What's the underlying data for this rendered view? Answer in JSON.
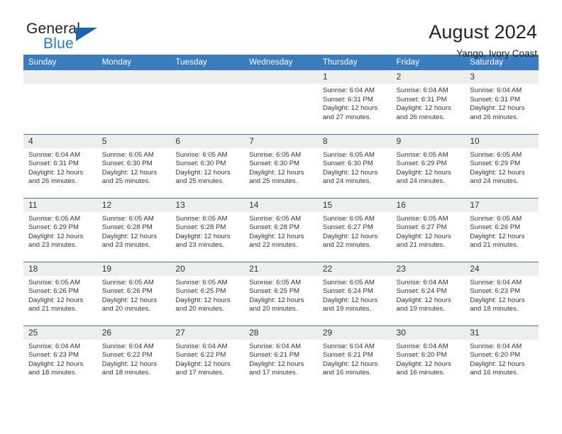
{
  "brand": {
    "name_part1": "General",
    "name_part2": "Blue",
    "triangle_icon": "triangle-icon",
    "accent_color": "#1665ad",
    "blue_text_color": "#1f7fc4"
  },
  "header": {
    "title": "August 2024",
    "location": "Yango, Ivory Coast"
  },
  "theme": {
    "header_row_bg": "#3a7cbe",
    "daynum_bg": "#eeeeee",
    "text_color": "#333333"
  },
  "weekday_headers": [
    "Sunday",
    "Monday",
    "Tuesday",
    "Wednesday",
    "Thursday",
    "Friday",
    "Saturday"
  ],
  "labels": {
    "sunrise": "Sunrise:",
    "sunset": "Sunset:",
    "daylight": "Daylight:"
  },
  "weeks": [
    [
      {
        "day": "",
        "empty": true
      },
      {
        "day": "",
        "empty": true
      },
      {
        "day": "",
        "empty": true
      },
      {
        "day": "",
        "empty": true
      },
      {
        "day": "1",
        "sunrise": "Sunrise: 6:04 AM",
        "sunset": "Sunset: 6:31 PM",
        "daylight_1": "Daylight: 12 hours",
        "daylight_2": "and 27 minutes."
      },
      {
        "day": "2",
        "sunrise": "Sunrise: 6:04 AM",
        "sunset": "Sunset: 6:31 PM",
        "daylight_1": "Daylight: 12 hours",
        "daylight_2": "and 26 minutes."
      },
      {
        "day": "3",
        "sunrise": "Sunrise: 6:04 AM",
        "sunset": "Sunset: 6:31 PM",
        "daylight_1": "Daylight: 12 hours",
        "daylight_2": "and 26 minutes."
      }
    ],
    [
      {
        "day": "4",
        "sunrise": "Sunrise: 6:04 AM",
        "sunset": "Sunset: 6:31 PM",
        "daylight_1": "Daylight: 12 hours",
        "daylight_2": "and 26 minutes."
      },
      {
        "day": "5",
        "sunrise": "Sunrise: 6:05 AM",
        "sunset": "Sunset: 6:30 PM",
        "daylight_1": "Daylight: 12 hours",
        "daylight_2": "and 25 minutes."
      },
      {
        "day": "6",
        "sunrise": "Sunrise: 6:05 AM",
        "sunset": "Sunset: 6:30 PM",
        "daylight_1": "Daylight: 12 hours",
        "daylight_2": "and 25 minutes."
      },
      {
        "day": "7",
        "sunrise": "Sunrise: 6:05 AM",
        "sunset": "Sunset: 6:30 PM",
        "daylight_1": "Daylight: 12 hours",
        "daylight_2": "and 25 minutes."
      },
      {
        "day": "8",
        "sunrise": "Sunrise: 6:05 AM",
        "sunset": "Sunset: 6:30 PM",
        "daylight_1": "Daylight: 12 hours",
        "daylight_2": "and 24 minutes."
      },
      {
        "day": "9",
        "sunrise": "Sunrise: 6:05 AM",
        "sunset": "Sunset: 6:29 PM",
        "daylight_1": "Daylight: 12 hours",
        "daylight_2": "and 24 minutes."
      },
      {
        "day": "10",
        "sunrise": "Sunrise: 6:05 AM",
        "sunset": "Sunset: 6:29 PM",
        "daylight_1": "Daylight: 12 hours",
        "daylight_2": "and 24 minutes."
      }
    ],
    [
      {
        "day": "11",
        "sunrise": "Sunrise: 6:05 AM",
        "sunset": "Sunset: 6:29 PM",
        "daylight_1": "Daylight: 12 hours",
        "daylight_2": "and 23 minutes."
      },
      {
        "day": "12",
        "sunrise": "Sunrise: 6:05 AM",
        "sunset": "Sunset: 6:28 PM",
        "daylight_1": "Daylight: 12 hours",
        "daylight_2": "and 23 minutes."
      },
      {
        "day": "13",
        "sunrise": "Sunrise: 6:05 AM",
        "sunset": "Sunset: 6:28 PM",
        "daylight_1": "Daylight: 12 hours",
        "daylight_2": "and 23 minutes."
      },
      {
        "day": "14",
        "sunrise": "Sunrise: 6:05 AM",
        "sunset": "Sunset: 6:28 PM",
        "daylight_1": "Daylight: 12 hours",
        "daylight_2": "and 22 minutes."
      },
      {
        "day": "15",
        "sunrise": "Sunrise: 6:05 AM",
        "sunset": "Sunset: 6:27 PM",
        "daylight_1": "Daylight: 12 hours",
        "daylight_2": "and 22 minutes."
      },
      {
        "day": "16",
        "sunrise": "Sunrise: 6:05 AM",
        "sunset": "Sunset: 6:27 PM",
        "daylight_1": "Daylight: 12 hours",
        "daylight_2": "and 21 minutes."
      },
      {
        "day": "17",
        "sunrise": "Sunrise: 6:05 AM",
        "sunset": "Sunset: 6:26 PM",
        "daylight_1": "Daylight: 12 hours",
        "daylight_2": "and 21 minutes."
      }
    ],
    [
      {
        "day": "18",
        "sunrise": "Sunrise: 6:05 AM",
        "sunset": "Sunset: 6:26 PM",
        "daylight_1": "Daylight: 12 hours",
        "daylight_2": "and 21 minutes."
      },
      {
        "day": "19",
        "sunrise": "Sunrise: 6:05 AM",
        "sunset": "Sunset: 6:26 PM",
        "daylight_1": "Daylight: 12 hours",
        "daylight_2": "and 20 minutes."
      },
      {
        "day": "20",
        "sunrise": "Sunrise: 6:05 AM",
        "sunset": "Sunset: 6:25 PM",
        "daylight_1": "Daylight: 12 hours",
        "daylight_2": "and 20 minutes."
      },
      {
        "day": "21",
        "sunrise": "Sunrise: 6:05 AM",
        "sunset": "Sunset: 6:25 PM",
        "daylight_1": "Daylight: 12 hours",
        "daylight_2": "and 20 minutes."
      },
      {
        "day": "22",
        "sunrise": "Sunrise: 6:05 AM",
        "sunset": "Sunset: 6:24 PM",
        "daylight_1": "Daylight: 12 hours",
        "daylight_2": "and 19 minutes."
      },
      {
        "day": "23",
        "sunrise": "Sunrise: 6:04 AM",
        "sunset": "Sunset: 6:24 PM",
        "daylight_1": "Daylight: 12 hours",
        "daylight_2": "and 19 minutes."
      },
      {
        "day": "24",
        "sunrise": "Sunrise: 6:04 AM",
        "sunset": "Sunset: 6:23 PM",
        "daylight_1": "Daylight: 12 hours",
        "daylight_2": "and 18 minutes."
      }
    ],
    [
      {
        "day": "25",
        "sunrise": "Sunrise: 6:04 AM",
        "sunset": "Sunset: 6:23 PM",
        "daylight_1": "Daylight: 12 hours",
        "daylight_2": "and 18 minutes."
      },
      {
        "day": "26",
        "sunrise": "Sunrise: 6:04 AM",
        "sunset": "Sunset: 6:22 PM",
        "daylight_1": "Daylight: 12 hours",
        "daylight_2": "and 18 minutes."
      },
      {
        "day": "27",
        "sunrise": "Sunrise: 6:04 AM",
        "sunset": "Sunset: 6:22 PM",
        "daylight_1": "Daylight: 12 hours",
        "daylight_2": "and 17 minutes."
      },
      {
        "day": "28",
        "sunrise": "Sunrise: 6:04 AM",
        "sunset": "Sunset: 6:21 PM",
        "daylight_1": "Daylight: 12 hours",
        "daylight_2": "and 17 minutes."
      },
      {
        "day": "29",
        "sunrise": "Sunrise: 6:04 AM",
        "sunset": "Sunset: 6:21 PM",
        "daylight_1": "Daylight: 12 hours",
        "daylight_2": "and 16 minutes."
      },
      {
        "day": "30",
        "sunrise": "Sunrise: 6:04 AM",
        "sunset": "Sunset: 6:20 PM",
        "daylight_1": "Daylight: 12 hours",
        "daylight_2": "and 16 minutes."
      },
      {
        "day": "31",
        "sunrise": "Sunrise: 6:04 AM",
        "sunset": "Sunset: 6:20 PM",
        "daylight_1": "Daylight: 12 hours",
        "daylight_2": "and 16 minutes."
      }
    ]
  ]
}
